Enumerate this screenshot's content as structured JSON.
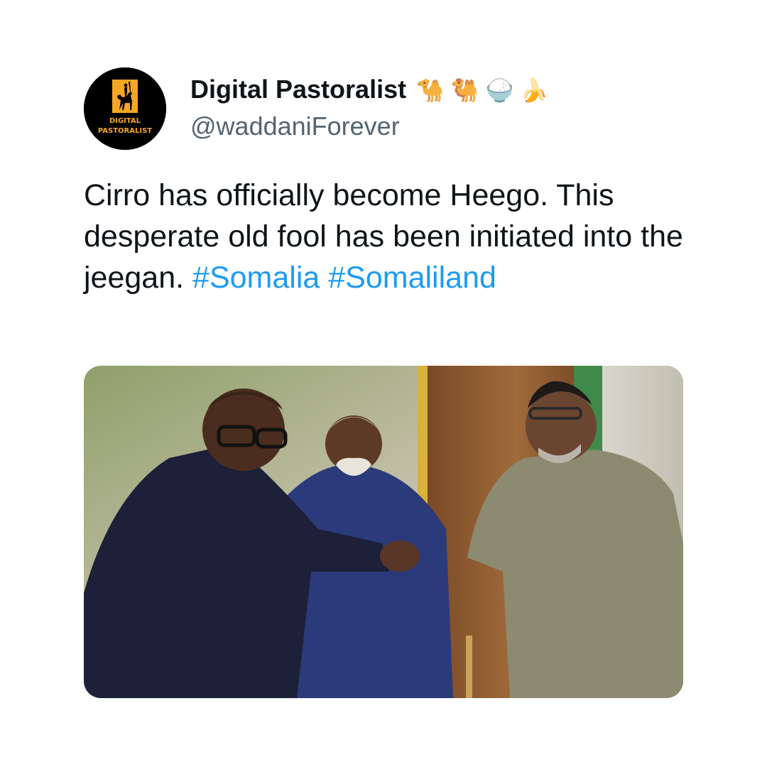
{
  "author": {
    "display_name": "Digital Pastoralist",
    "name_emojis": "🐪 🐫 🍚 🍌",
    "handle": "@waddaniForever",
    "avatar": {
      "text_line1": "DIGITAL",
      "text_line2": "PASTORALIST",
      "icon": "camel-rider-logo-icon",
      "accent": "#f5a623"
    }
  },
  "tweet": {
    "text": "Cirro has officially become Heego. This desperate old fool has been initiated into the jeegan.",
    "hashtags": [
      "#Somalia",
      "#Somaliland"
    ]
  },
  "media": {
    "type": "photo",
    "description_icon": "photo-three-men-handshake"
  },
  "colors": {
    "text": "#0f1419",
    "secondary": "#536471",
    "link": "#1d9bf0"
  }
}
